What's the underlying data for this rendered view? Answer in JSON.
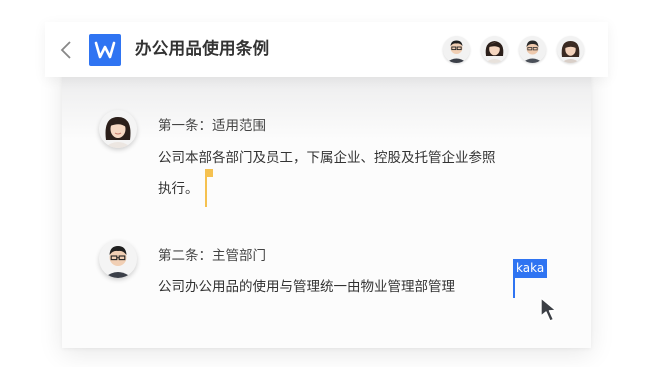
{
  "document": {
    "title": "办公用品使用条例"
  },
  "collaborators": [
    "avatar-man-glasses",
    "avatar-woman",
    "avatar-man-short-hair",
    "avatar-woman-2"
  ],
  "sections": [
    {
      "heading": "第一条：适用范围",
      "body_line1": "公司本部各部门及员工，下属企业、控股及托管企业参照",
      "body_line2": "执行。"
    },
    {
      "heading": "第二条：主管部门",
      "body_line1": "公司办公用品的使用与管理统一由物业管理部管理"
    }
  ],
  "remote_cursor": {
    "user": "kaka"
  },
  "colors": {
    "accent_blue": "#2f74f2",
    "caret_yellow": "#f5c150"
  }
}
